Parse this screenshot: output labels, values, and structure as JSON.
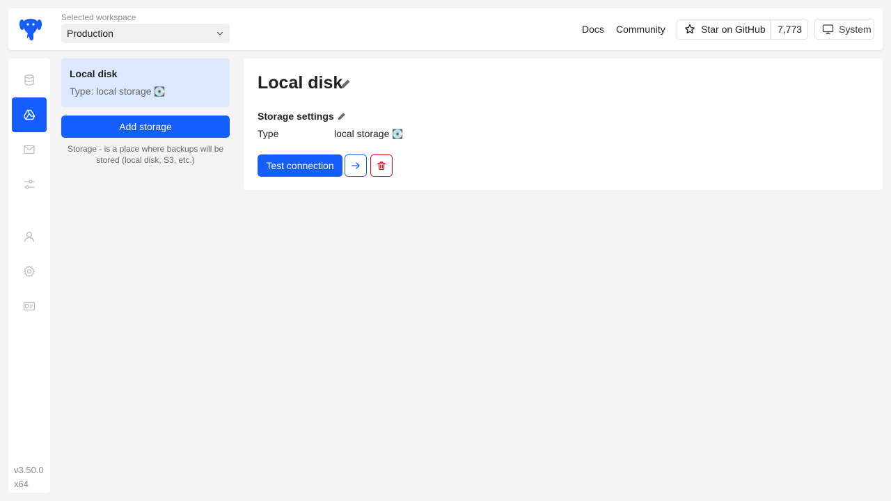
{
  "header": {
    "logo_icon": "elephant-logo-icon",
    "workspace_label": "Selected workspace",
    "workspace_value": "Production",
    "docs_label": "Docs",
    "community_label": "Community",
    "github_label": "Star on GitHub",
    "github_count": "7,773",
    "theme_label": "System"
  },
  "sidebar": {
    "items": [
      {
        "name": "databases",
        "icon": "database-icon",
        "active": false
      },
      {
        "name": "storages",
        "icon": "drive-icon",
        "active": true
      },
      {
        "name": "notifiers",
        "icon": "mail-icon",
        "active": false
      },
      {
        "name": "settings-sliders",
        "icon": "sliders-icon",
        "active": false
      },
      {
        "name": "profile",
        "icon": "user-icon",
        "active": false
      },
      {
        "name": "settings",
        "icon": "gear-icon",
        "active": false
      },
      {
        "name": "about",
        "icon": "id-card-icon",
        "active": false
      }
    ],
    "version_line1": "v3.50.0",
    "version_line2": "x64"
  },
  "storage_list": {
    "items": [
      {
        "name": "Local disk",
        "type_text": "Type: local storage",
        "type_emoji": "💽"
      }
    ],
    "add_button": "Add storage",
    "hint": "Storage - is a place where backups will be stored (local disk, S3, etc.)"
  },
  "detail": {
    "title": "Local disk",
    "section_title": "Storage settings",
    "type_label": "Type",
    "type_value": "local storage",
    "type_emoji": "💽",
    "test_button": "Test connection"
  },
  "colors": {
    "accent": "#155dfc",
    "active_card": "#dbe8fe",
    "danger": "#e7000b"
  }
}
